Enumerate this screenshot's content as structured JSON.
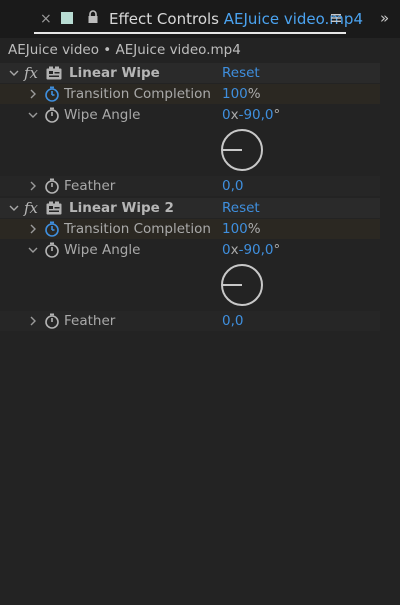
{
  "panel": {
    "close_glyph": "×",
    "title_prefix": "Effect Controls ",
    "title_clip": "AEJuice video.mp4",
    "swatch_color": "#b8dcd3",
    "overflow_glyph": "»"
  },
  "breadcrumb": "AEJuice video • AEJuice video.mp4",
  "effects": [
    {
      "fx": "fx",
      "name": "Linear Wipe",
      "reset": "Reset",
      "completion_label": "Transition Completion",
      "completion_value": "100",
      "completion_unit": "%",
      "angle_label": "Wipe Angle",
      "angle_turns": "0",
      "angle_x": "x",
      "angle_degrees": "-90,0",
      "angle_deg_unit": "°",
      "feather_label": "Feather",
      "feather_value": "0,0"
    },
    {
      "fx": "fx",
      "name": "Linear Wipe 2",
      "reset": "Reset",
      "completion_label": "Transition Completion",
      "completion_value": "100",
      "completion_unit": "%",
      "angle_label": "Wipe Angle",
      "angle_turns": "0",
      "angle_x": "x",
      "angle_degrees": "-90,0",
      "angle_deg_unit": "°",
      "feather_label": "Feather",
      "feather_value": "0,0"
    }
  ],
  "colors": {
    "accent": "#3f8fde",
    "clip_name": "#4ba3f0",
    "background": "#232323"
  }
}
